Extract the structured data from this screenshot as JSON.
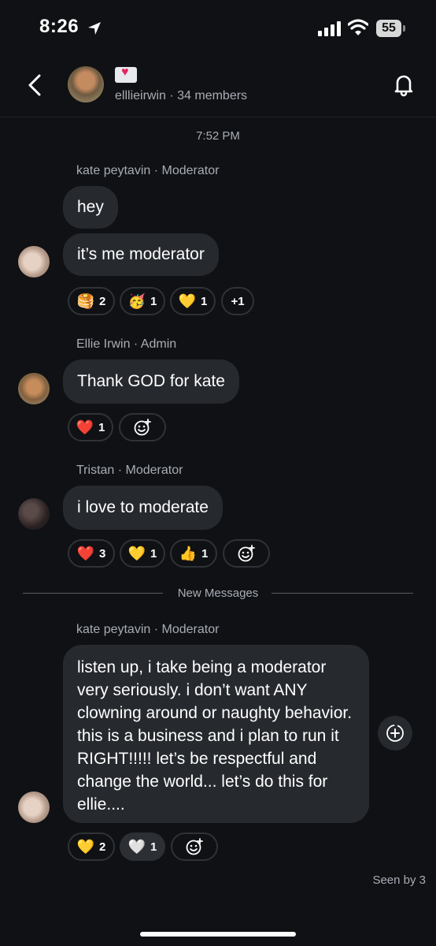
{
  "status_bar": {
    "time": "8:26",
    "battery": "55"
  },
  "header": {
    "emoji": "💌",
    "subtitle": "elllieirwin · 34 members"
  },
  "timestamp": "7:52 PM",
  "messages": [
    {
      "sender": "kate peytavin · Moderator",
      "bubbles": [
        "hey",
        "it’s me moderator"
      ],
      "reactions": [
        {
          "emoji": "🥞",
          "count": "2"
        },
        {
          "emoji": "🥳",
          "count": "1"
        },
        {
          "emoji": "💛",
          "count": "1"
        },
        {
          "emoji": "",
          "count": "+1"
        }
      ]
    },
    {
      "sender": "Ellie Irwin · Admin",
      "bubbles": [
        "Thank GOD for kate"
      ],
      "reactions": [
        {
          "emoji": "❤️",
          "count": "1"
        }
      ]
    },
    {
      "sender": "Tristan · Moderator",
      "bubbles": [
        "i love to moderate"
      ],
      "reactions": [
        {
          "emoji": "❤️",
          "count": "3"
        },
        {
          "emoji": "💛",
          "count": "1"
        },
        {
          "emoji": "👍",
          "count": "1"
        }
      ]
    },
    {
      "sender": "kate peytavin · Moderator",
      "bubbles": [
        "listen up, i take being a moderator very seriously. i don’t want ANY clowning around or naughty behavior. this is a business and i plan to run it RIGHT!!!!! let’s be respectful and change the world... let’s do this for ellie...."
      ],
      "reactions": [
        {
          "emoji": "💛",
          "count": "2"
        },
        {
          "emoji": "🤍",
          "count": "1"
        }
      ]
    }
  ],
  "divider_label": "New Messages",
  "seen_by": "Seen by 3",
  "icons": {
    "back": "chevron-left-icon",
    "bell": "bell-icon",
    "add_reaction": "smile-plus-icon",
    "action": "circle-plus-icon"
  }
}
